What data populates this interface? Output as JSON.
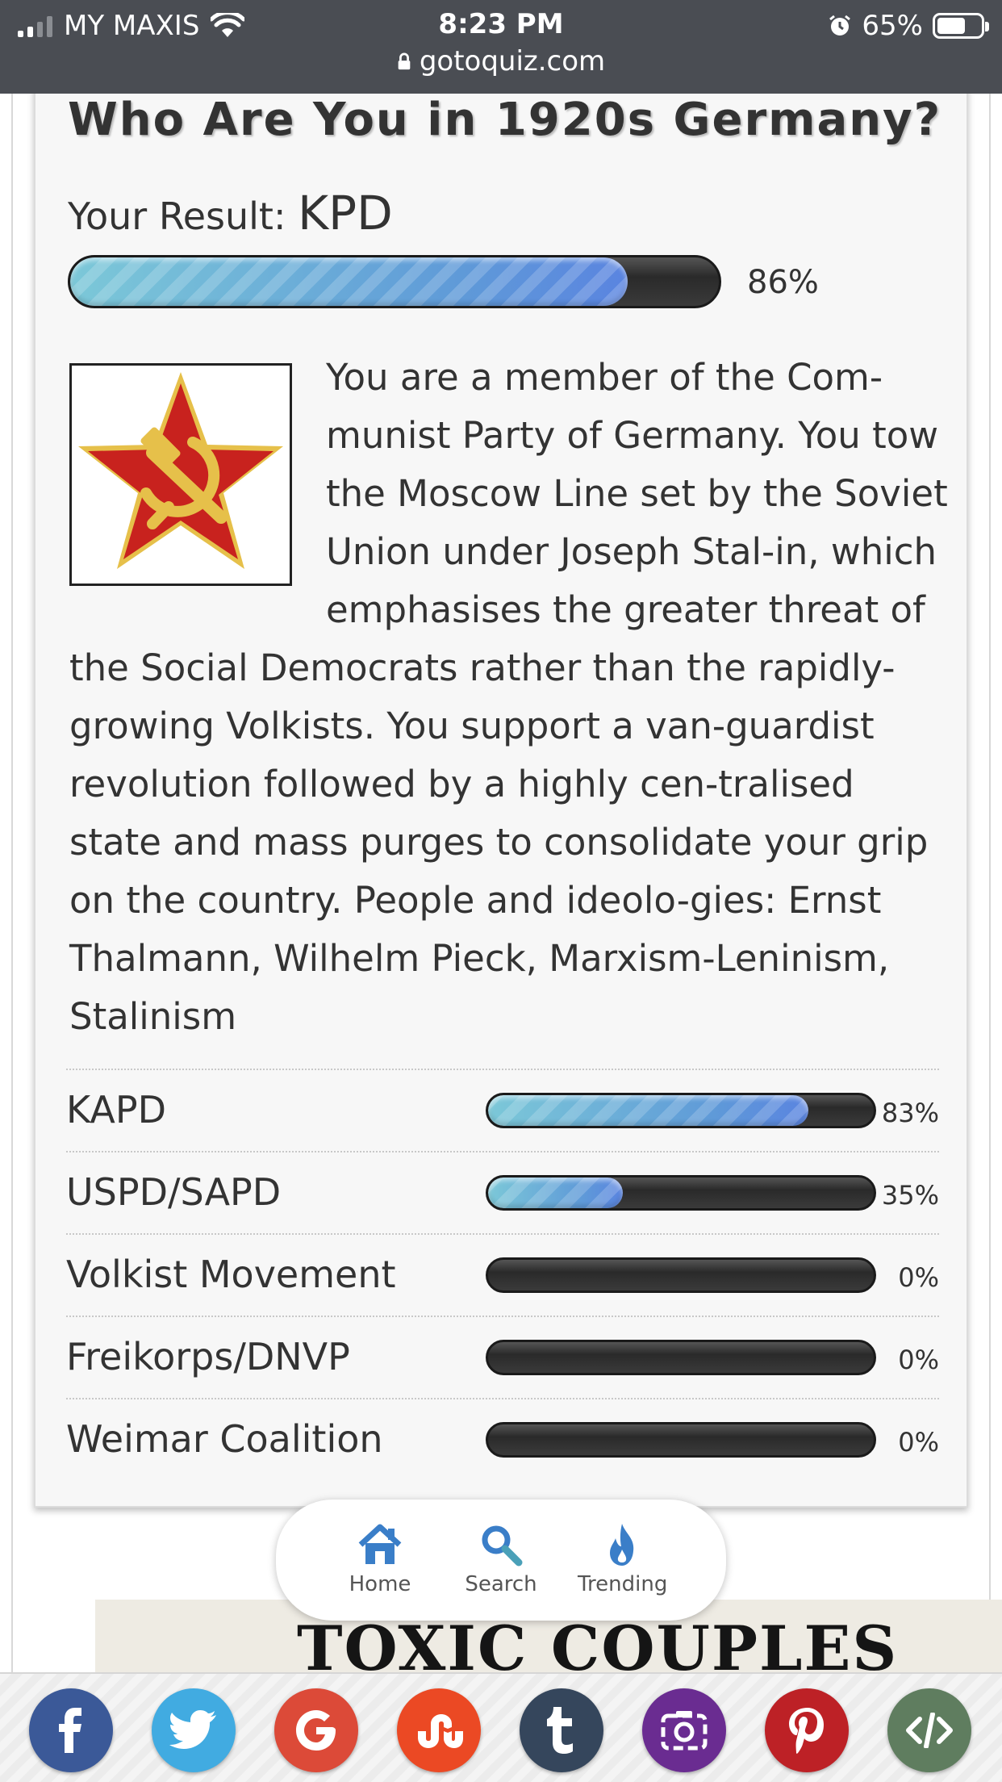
{
  "status_bar": {
    "carrier": "MY MAXIS",
    "time": "8:23 PM",
    "battery": "65%",
    "url": "gotoquiz.com"
  },
  "quiz": {
    "title": "Who Are You in 1920s Germany?",
    "result_label": "Your Result:",
    "result_value": "KPD",
    "result_percent": "86%",
    "result_fraction": 0.86,
    "description": "You are a member of the Com-munist Party of Germany. You tow the Moscow Line set by the Soviet Union under Joseph Stal-in, which emphasises the greater threat of the Social Democrats rather than the rapidly-growing Volkists. You support a van-guardist revolution followed by a highly cen-tralised state and mass purges to consolidate your grip on the country. People and ideolo-gies: Ernst Thalmann, Wilhelm Pieck, Marxism-Leninism, Stalinism",
    "other_results": [
      {
        "label": "KAPD",
        "percent": "83%",
        "fraction": 0.83
      },
      {
        "label": "USPD/SAPD",
        "percent": "35%",
        "fraction": 0.35
      },
      {
        "label": "Volkist Movement",
        "percent": "0%",
        "fraction": 0
      },
      {
        "label": "Freikorps/DNVP",
        "percent": "0%",
        "fraction": 0
      },
      {
        "label": "Weimar Coalition",
        "percent": "0%",
        "fraction": 0
      }
    ]
  },
  "nav": {
    "home": "Home",
    "search": "Search",
    "trending": "Trending"
  },
  "ad": {
    "headline": "TOXIC COUPLES"
  },
  "share": {
    "colors": {
      "facebook": "#3b5998",
      "twitter": "#41abe1",
      "google": "#dc4a38",
      "stumbleupon": "#eb4924",
      "tumblr": "#35465c",
      "instagram": "#6a2c91",
      "pinterest": "#bd2126",
      "embed": "#5f7d5f"
    }
  }
}
